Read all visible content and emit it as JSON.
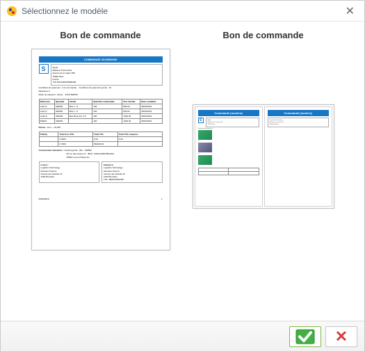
{
  "window": {
    "title": "Sélectionnez le modèle"
  },
  "options": [
    {
      "label": "Bon de commande"
    },
    {
      "label": "Bon de commande"
    }
  ],
  "doc": {
    "banner": "COMMANDE 2019050905",
    "logo_letter": "S",
    "client": {
      "name": "Apple",
      "contact": "Madame Portnanche",
      "addr1": "Avenue de la nation 556",
      "zipcity": "75000 Paris",
      "country": "France",
      "vat_label": "TVA",
      "vat": "FR12345678989409"
    },
    "terms": {
      "cond_label": "Conditions de paiement :",
      "cond_val": "A la commande",
      "days_label": "Conditions de paiement (jours) :",
      "days_val": "15",
      "ref_label": "Référence",
      "ref_val": "0",
      "mode_label": "Mode de transport :",
      "mode_val": "Route",
      "inco_label": "INCOTERMS :"
    },
    "lines_head": [
      "Référence",
      "Quantité",
      "Libellé",
      "Quantité commandée",
      "Prix d'achat",
      "Date souhaitée"
    ],
    "lines": [
      [
        "mac1.5",
        "300000",
        "Mac 1 ..5",
        "130",
        "800.00",
        "26/04/2019"
      ],
      [
        "mac1.6",
        "500000",
        "Mac 1 ..6",
        "130",
        "800.00",
        "26/04/2019"
      ],
      [
        "ma24.5",
        "300000",
        "Mac Book Pro 1.5",
        "100",
        "1000.00",
        "26/04/2019"
      ],
      [
        "096621",
        "300000",
        "",
        "100",
        "1000.00",
        "26/04/2019"
      ]
    ],
    "totals": {
      "currency_label": "Devise :",
      "currency": "euro — EURO",
      "head": [
        "TVA(%)",
        "Total hors TVA",
        "Total TVA",
        "Total TVA comprise"
      ],
      "rows": [
        [
          "",
          "5.0000",
          "0.00",
          "0.00"
        ],
        [
          "",
          "0.7900",
          "560000.00",
          ""
        ]
      ]
    },
    "bank": {
      "label": "Coordonnées bancaires :",
      "name": "Crédit Agricole",
      "addr1": "56 rue des fossés 12",
      "zipcity": "25000 Lorg ont Mayenne",
      "bic_label": "BIC :",
      "bic": "048552",
      "iban_label": "IBAN :",
      "iban": "FR012345678910112"
    },
    "delivery": {
      "left_title": "Livré à :",
      "right_title": "Facturé à :",
      "company": "Logistics Technology",
      "name": "Monsieur Dupont",
      "addr": "Avenue des acacias 12",
      "zipcity": "1000 Bruxelles",
      "vat_label": "TVA :",
      "vat": "BE0123456789"
    },
    "footer_left": "25/05/2019",
    "footer_right": "1",
    "banner2": "Commande [numéro]"
  }
}
